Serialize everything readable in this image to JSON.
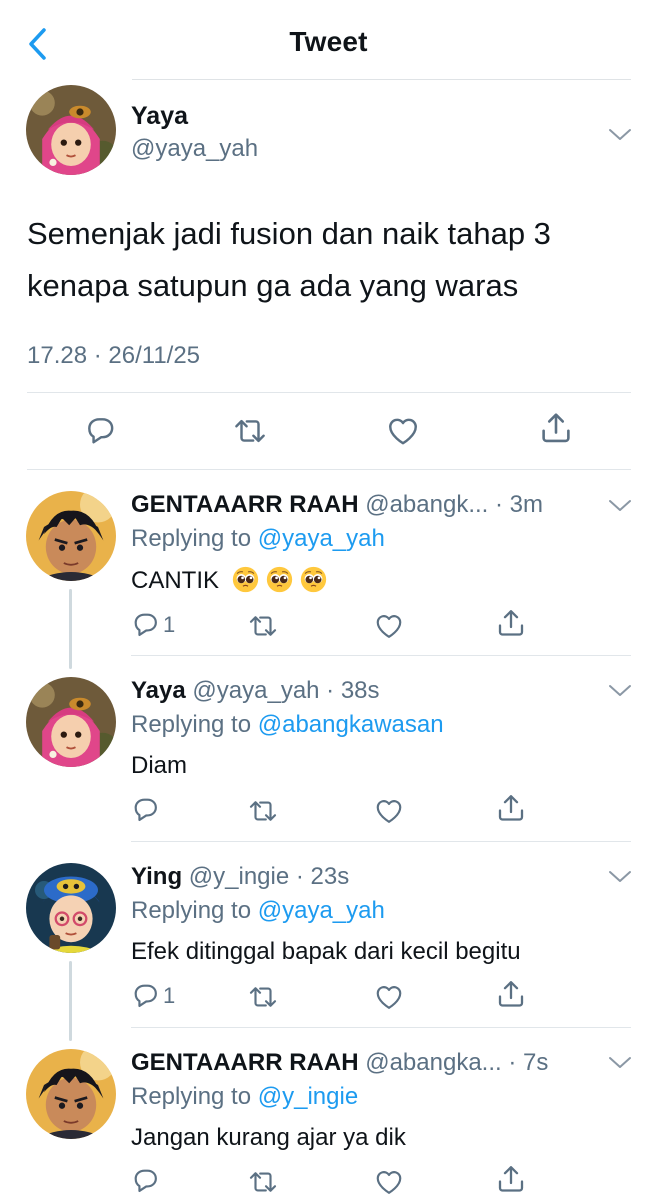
{
  "header": {
    "title": "Tweet",
    "back_icon": "chevron-left-icon"
  },
  "colors": {
    "accent": "#1d9bf0",
    "secondary_text": "#5b7083",
    "primary_text": "#0f1419",
    "divider": "#e1e6ea"
  },
  "main_tweet": {
    "name": "Yaya",
    "handle": "@yaya_yah",
    "text": "Semenjak jadi fusion dan naik tahap 3 kenapa satupun ga ada yang waras",
    "timestamp": "17.28 · 26/11/25",
    "actions": [
      "reply-icon",
      "retweet-icon",
      "like-icon",
      "share-icon"
    ]
  },
  "replies": [
    {
      "name": "GENTAAARR RAAH",
      "handle_time": "@abangk... · 3m",
      "replying_prefix": "Replying to",
      "mention": "@yaya_yah",
      "text": "CANTIK",
      "emojis": [
        "pleading-face-emoji",
        "pleading-face-emoji",
        "pleading-face-emoji"
      ],
      "reply_count": "1"
    },
    {
      "name": "Yaya",
      "handle_time": "@yaya_yah · 38s",
      "replying_prefix": "Replying to",
      "mention": "@abangkawasan",
      "text": "Diam",
      "reply_count": ""
    },
    {
      "name": "Ying",
      "handle_time": "@y_ingie · 23s",
      "replying_prefix": "Replying to",
      "mention": "@yaya_yah",
      "text": "Efek ditinggal bapak dari kecil begitu",
      "reply_count": "1"
    },
    {
      "name": "GENTAAARR RAAH",
      "handle_time": "@abangka... · 7s",
      "replying_prefix": "Replying to",
      "mention": "@y_ingie",
      "text": "Jangan kurang ajar ya dik",
      "reply_count": ""
    }
  ]
}
